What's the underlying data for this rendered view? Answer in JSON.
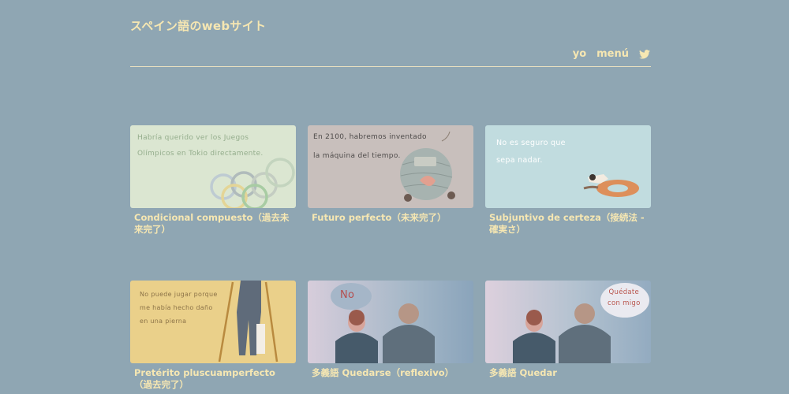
{
  "header": {
    "site_title": "スペイン語のwebサイト",
    "nav": {
      "yo": "yo",
      "menu": "menú",
      "twitter_icon": "twitter-icon"
    }
  },
  "cards": [
    {
      "title": "Condicional compuesto（過去未来完了）",
      "image_text": [
        "Habría querido ver los Juegos",
        " Olímpicos en Tokio directamente."
      ],
      "bg": "#dbe6d1"
    },
    {
      "title": "Futuro perfecto（未来完了）",
      "image_text": [
        "En 2100, habremos inventado",
        "la máquina del tiempo."
      ],
      "bg": "#c8bfbc"
    },
    {
      "title": "Subjuntivo de certeza（接続法 - 確実さ）",
      "image_text": [
        "No es seguro que",
        "sepa nadar."
      ],
      "bg": "#c1dcdf"
    },
    {
      "title": "Pretérito pluscuamperfecto（過去完了）",
      "image_text": [
        "No puede jugar porque",
        "me había hecho daño",
        "en una pierna"
      ],
      "bg": "#ead08a"
    },
    {
      "title": "多義語 Quedarse（reflexivo）",
      "image_text": [
        "No"
      ],
      "bg": "#c8c9d8"
    },
    {
      "title": "多義語 Quedar",
      "image_text": [
        "Quédate",
        "con migo"
      ],
      "bg": "#cfc8d8"
    }
  ]
}
